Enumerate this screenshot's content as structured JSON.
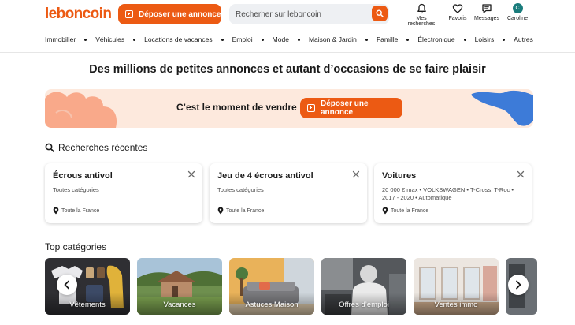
{
  "header": {
    "logo": "leboncoin",
    "post_button": "Déposer une annonce",
    "search_placeholder": "Recherher sur leboncoin",
    "icons": [
      {
        "label": "Mes recherches",
        "icon": "bell-icon"
      },
      {
        "label": "Favoris",
        "icon": "heart-icon"
      },
      {
        "label": "Messages",
        "icon": "message-icon"
      },
      {
        "label": "Caroline",
        "icon": "avatar",
        "initial": "C"
      }
    ],
    "accent_color": "#ec5a13"
  },
  "categories_nav": [
    "Immobilier",
    "Véhicules",
    "Locations de vacances",
    "Emploi",
    "Mode",
    "Maison & Jardin",
    "Famille",
    "Électronique",
    "Loisirs",
    "Autres"
  ],
  "hero": {
    "title": "Des millions de petites annonces et autant d’occasions de se faire plaisir",
    "banner_text": "C’est le moment de vendre",
    "banner_button": "Déposer une annonce"
  },
  "recent_searches": {
    "title": "Recherches récentes",
    "items": [
      {
        "title": "Écrous antivol",
        "subtitle": "Toutes catégories",
        "location": "Toute la France"
      },
      {
        "title": "Jeu de 4 écrous antivol",
        "subtitle": "Toutes catégories",
        "location": "Toute la France"
      },
      {
        "title": "Voitures",
        "subtitle": "20 000 € max • VOLKSWAGEN • T-Cross, T-Roc • 2017 - 2020 • Automatique",
        "location": "Toute la France"
      }
    ]
  },
  "top_categories": {
    "title": "Top catégories",
    "items": [
      {
        "label": "Vêtements"
      },
      {
        "label": "Vacances"
      },
      {
        "label": "Astuces Maison"
      },
      {
        "label": "Offres d’emploi"
      },
      {
        "label": "Ventes immo"
      }
    ]
  }
}
